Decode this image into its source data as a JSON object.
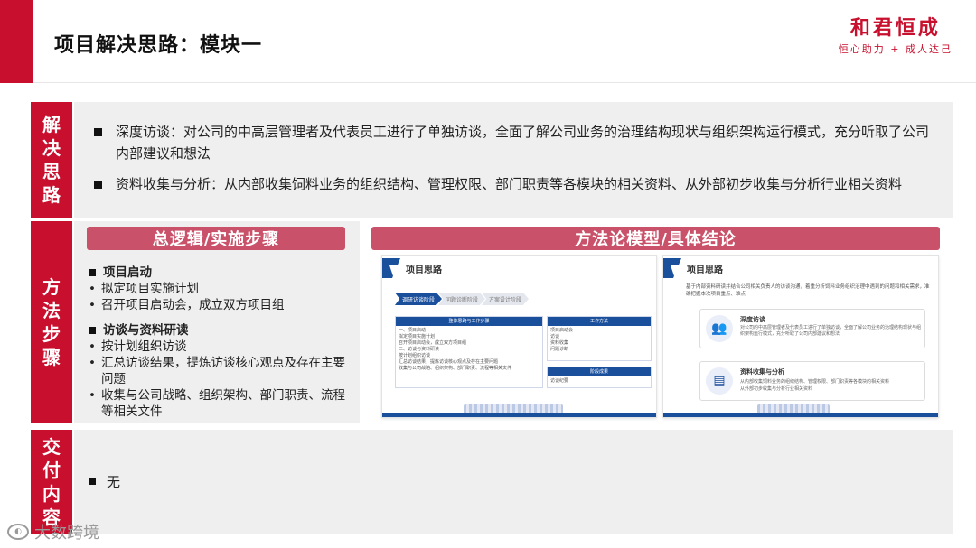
{
  "header": {
    "title": "项目解决思路：模块一",
    "brand_name": "和君恒成",
    "brand_slogan": "恒心助力 + 成人达己"
  },
  "section_solution": {
    "tab_label": "解决思路",
    "bullets": [
      "深度访谈：对公司的中高层管理者及代表员工进行了单独访谈，全面了解公司业务的治理结构现状与组织架构运行模式，充分听取了公司内部建议和想法",
      "资料收集与分析：从内部收集饲料业务的组织结构、管理权限、部门职责等各模块的相关资料、从外部初步收集与分析行业相关资料"
    ]
  },
  "section_method": {
    "tab_label": "方法步骤",
    "left_pill": "总逻辑/实施步骤",
    "right_pill": "方法论模型/具体结论",
    "steps": [
      {
        "heading": "项目启动",
        "items": [
          "拟定项目实施计划",
          "召开项目启动会，成立双方项目组"
        ]
      },
      {
        "heading": "访谈与资料研读",
        "items": [
          "按计划组织访谈",
          "汇总访谈结果，提炼访谈核心观点及存在主要问题",
          "收集与公司战略、组织架构、部门职责、流程等相关文件"
        ]
      }
    ],
    "thumb_left": {
      "title": "项目思路",
      "chevrons": [
        "调研访谈阶段",
        "问题诊断阶段",
        "方案设计阶段"
      ],
      "panel_a_title": "整体思路与工作步骤",
      "panel_a_lines": [
        "一、项目启动",
        "拟定项目实施计划",
        "召开项目启动会，成立双方项目组",
        "二、访谈与资料研读",
        "按计划组织访谈",
        "汇总访谈结果，提炼访谈核心观点及存在主要问题",
        "收集与公司战略、组织架构、部门职责、流程等相关文件"
      ],
      "panel_b_title": "工作方法",
      "panel_b_lines": [
        "项目启动会",
        "访谈",
        "资料收集",
        "问题诊断"
      ],
      "panel_c_title": "阶段成果",
      "panel_c_lines": [
        "访谈纪要"
      ]
    },
    "thumb_right": {
      "title": "项目思路",
      "intro": "基于内部资料研读并结合公司相关负责人的访谈沟通，着重分析饲料业务组织治理中遇到的问题和相关需求，准确把握本次项目重点、难点",
      "card1_title": "深度访谈",
      "card1_text": "对公司的中高层管理者及代表员工进行了单独访谈，全面了解公司业务的治理结构现状与组织架构运行模式，充分听取了公司内部建议和想法",
      "card2_title": "资料收集与分析",
      "card2_lines": [
        "从内部收集饲料业务的组织结构、管理权限、部门职责等各模块的相关资料",
        "从外部初步收集与分析行业相关资料"
      ]
    }
  },
  "section_deliver": {
    "tab_label": "交付内容",
    "content": "无"
  },
  "watermark": {
    "text": "大数跨境"
  },
  "colors": {
    "brand_red": "#c8102e",
    "pill_rose": "#c9526a",
    "panel_gray": "#efefef",
    "thumb_blue": "#1a4f9c"
  }
}
